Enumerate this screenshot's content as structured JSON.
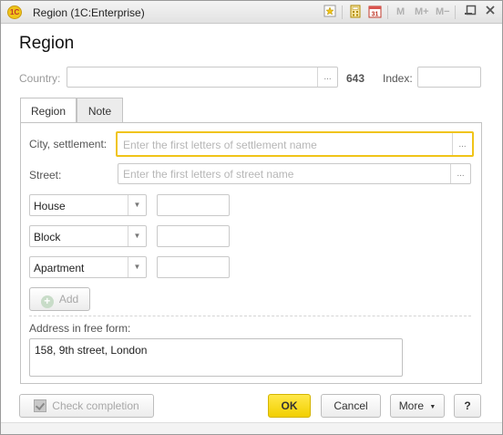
{
  "window": {
    "title": "Region  (1C:Enterprise)",
    "toolbar": {
      "m_label": "M",
      "m_plus_label": "M+",
      "m_minus_label": "M−"
    }
  },
  "form": {
    "title": "Region",
    "country_label": "Country:",
    "country_value": "",
    "country_code": "643",
    "index_label": "Index:",
    "index_value": ""
  },
  "tabs": [
    {
      "label": "Region",
      "active": true
    },
    {
      "label": "Note",
      "active": false
    }
  ],
  "region_tab": {
    "city_label": "City, settlement:",
    "city_placeholder": "Enter the first letters of settlement name",
    "street_label": "Street:",
    "street_placeholder": "Enter the first letters of street name",
    "combos": [
      {
        "value": "House"
      },
      {
        "value": "Block"
      },
      {
        "value": "Apartment"
      }
    ],
    "add_label": "Add",
    "free_form_label": "Address in free form:",
    "free_form_value": "158, 9th street, London"
  },
  "footer": {
    "check_label": "Check completion",
    "ok_label": "OK",
    "cancel_label": "Cancel",
    "more_label": "More",
    "help_label": "?"
  },
  "colors": {
    "accent": "#f2cf00",
    "active_border": "#f0c419"
  },
  "icons": [
    "app-1c-icon",
    "favorite-icon",
    "calculator-icon",
    "calendar-icon",
    "minimize-icon",
    "maximize-icon",
    "close-icon",
    "ellipsis-icon",
    "dropdown-arrow-icon",
    "add-icon",
    "check-icon"
  ]
}
